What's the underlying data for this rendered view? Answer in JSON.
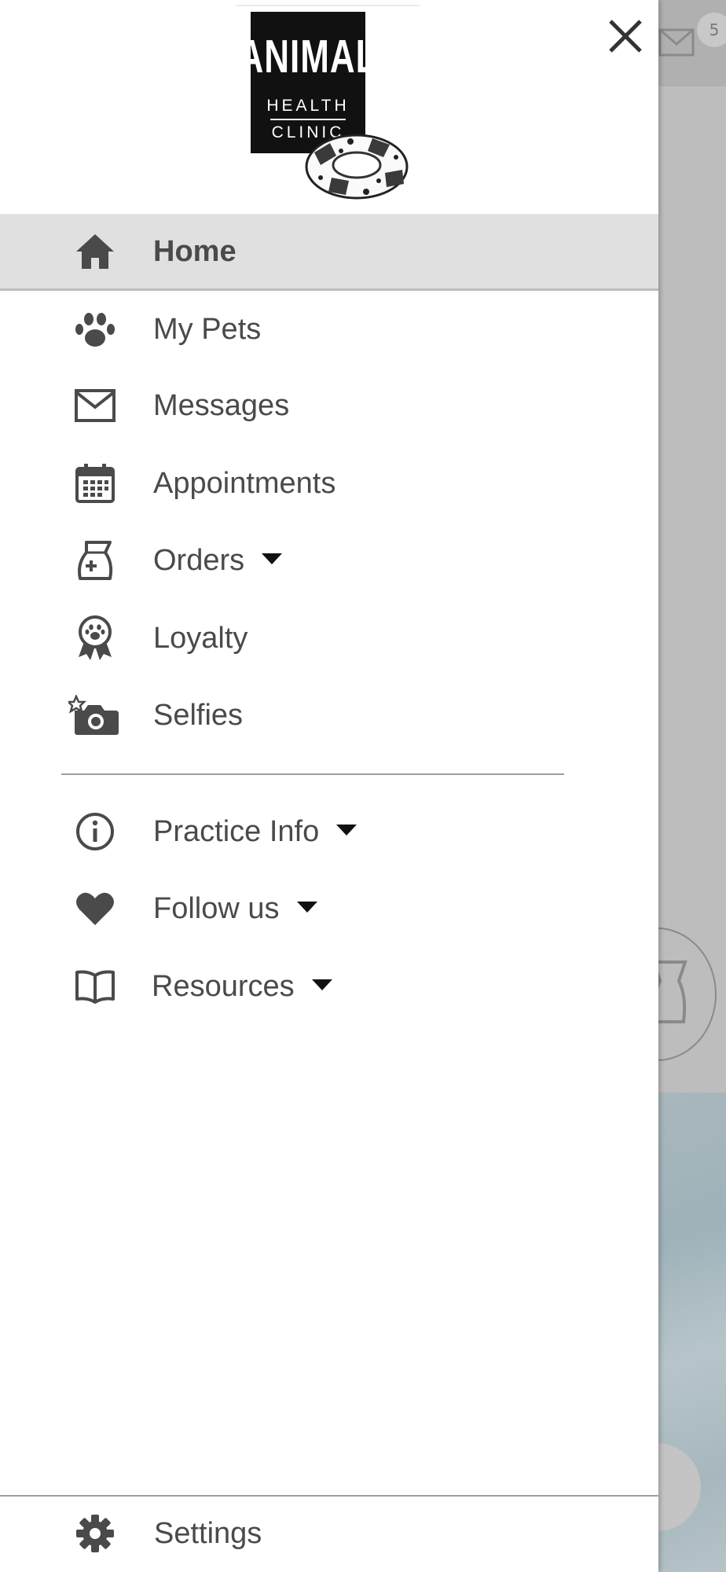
{
  "logo": {
    "line1": "ANIMAL",
    "line2": "HEALTH",
    "line3": "CLINIC"
  },
  "menu": {
    "home": "Home",
    "my_pets": "My Pets",
    "messages": "Messages",
    "appointments": "Appointments",
    "orders": "Orders",
    "loyalty": "Loyalty",
    "selfies": "Selfies",
    "practice_info": "Practice Info",
    "follow_us": "Follow us",
    "resources": "Resources",
    "settings": "Settings"
  },
  "background": {
    "message_badge": "5"
  },
  "icons": {
    "close": "close-icon",
    "home": "home-icon",
    "my_pets": "paw-icon",
    "messages": "envelope-icon",
    "appointments": "calendar-icon",
    "orders": "food-bag-icon",
    "loyalty": "award-ribbon-icon",
    "selfies": "camera-star-icon",
    "practice_info": "info-icon",
    "follow_us": "heart-icon",
    "resources": "book-icon",
    "settings": "gear-icon"
  },
  "colors": {
    "icon": "#4a4a4a",
    "active_bg": "#e0e0e0",
    "overlay": "#bdbdbd"
  }
}
